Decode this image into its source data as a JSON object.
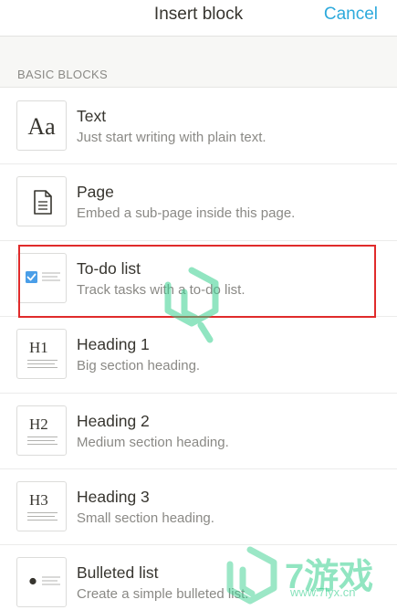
{
  "header": {
    "title": "Insert block",
    "cancel_label": "Cancel"
  },
  "section": {
    "label": "BASIC BLOCKS"
  },
  "blocks": [
    {
      "title": "Text",
      "description": "Just start writing with plain text.",
      "icon": "text-icon",
      "icon_text": "Aa"
    },
    {
      "title": "Page",
      "description": "Embed a sub-page inside this page.",
      "icon": "page-icon"
    },
    {
      "title": "To-do list",
      "description": "Track tasks with a to-do list.",
      "icon": "todo-checkbox-icon"
    },
    {
      "title": "Heading 1",
      "description": "Big section heading.",
      "icon": "heading1-icon",
      "icon_text": "H1"
    },
    {
      "title": "Heading 2",
      "description": "Medium section heading.",
      "icon": "heading2-icon",
      "icon_text": "H2"
    },
    {
      "title": "Heading 3",
      "description": "Small section heading.",
      "icon": "heading3-icon",
      "icon_text": "H3"
    },
    {
      "title": "Bulleted list",
      "description": "Create a simple bulleted list.",
      "icon": "bullet-icon"
    }
  ],
  "highlighted_block": "To-do list",
  "watermark": {
    "brand": "7游戏",
    "url": "www.7lyx.cn"
  },
  "colors": {
    "accent": "#2eaadc",
    "checkbox": "#4a9ee8",
    "highlight": "#e02b2b",
    "watermark": "#39d08f"
  }
}
